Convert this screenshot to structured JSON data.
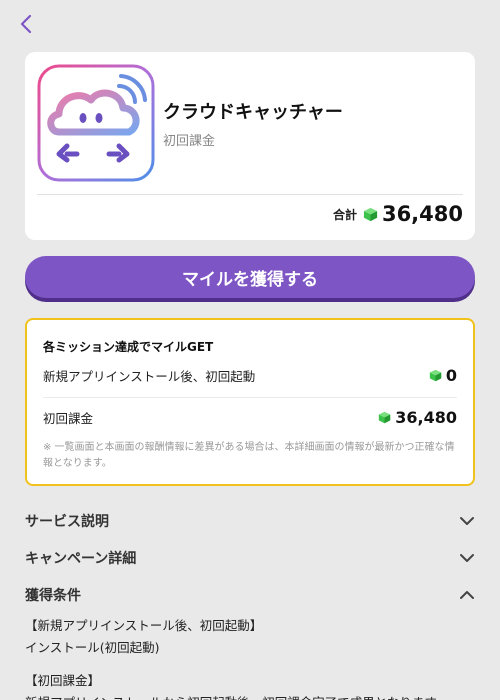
{
  "app": {
    "name": "クラウドキャッチャー",
    "subtitle": "初回課金",
    "total_label": "合計",
    "total_value": "36,480"
  },
  "cta": {
    "label": "マイルを獲得する"
  },
  "mission": {
    "title": "各ミッション達成でマイルGET",
    "rows": [
      {
        "label": "新規アプリインストール後、初回起動",
        "value": "0"
      },
      {
        "label": "初回課金",
        "value": "36,480"
      }
    ],
    "note": "※ 一覧画面と本画面の報酬情報に差異がある場合は、本詳細画面の情報が最新かつ正確な情報となります。"
  },
  "sections": [
    {
      "label": "サービス説明",
      "icon": "chevron-down-icon"
    },
    {
      "label": "キャンペーン詳細",
      "icon": "chevron-down-icon"
    },
    {
      "label": "獲得条件",
      "icon": "chevron-up-icon"
    }
  ],
  "conditions": [
    "【新規アプリインストール後、初回起動】",
    "インストール(初回起動)",
    "【初回課金】",
    "新規アプリインストールから初回起動後、初回課金完了で成果となります。"
  ],
  "colors": {
    "accent": "#7e55c4",
    "mission_border": "#f2c21c",
    "gem": "#3cc24a",
    "background": "#e9e9e9"
  }
}
